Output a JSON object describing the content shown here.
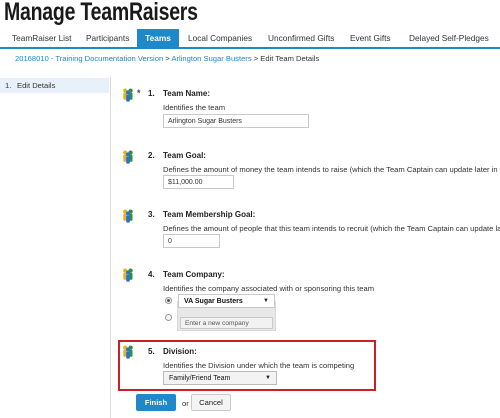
{
  "page": {
    "title": "Manage TeamRaisers"
  },
  "tabs": [
    {
      "label": "TeamRaiser List"
    },
    {
      "label": "Participants"
    },
    {
      "label": "Teams"
    },
    {
      "label": "Local Companies"
    },
    {
      "label": "Unconfirmed Gifts"
    },
    {
      "label": "Event Gifts"
    },
    {
      "label": "Delayed Self-Pledges"
    }
  ],
  "breadcrumb": {
    "item1": "20168010 - Training Documentation Version",
    "sep1": " > ",
    "item2": "Arlington Sugar Busters",
    "sep2": " > ",
    "current": "Edit Team Details"
  },
  "sidebar": {
    "items": [
      {
        "number": "1.",
        "label": "Edit Details"
      }
    ]
  },
  "form": {
    "required_marker": "*",
    "steps": [
      {
        "number": "1.",
        "label": "Team Name:",
        "description": "Identifies the team",
        "value": "Arlington Sugar Busters"
      },
      {
        "number": "2.",
        "label": "Team Goal:",
        "description": "Defines the amount of money the team intends to raise (which the Team Captain can update later in the",
        "value": "$11,000.00"
      },
      {
        "number": "3.",
        "label": "Team Membership Goal:",
        "description": "Defines the amount of people that this team intends to recruit (which the Team Captain can update late",
        "value": "0"
      },
      {
        "number": "4.",
        "label": "Team Company:",
        "description": "Identifies the company associated with or sponsoring this team",
        "selected_company": "VA Sugar Busters",
        "new_company_placeholder": "Enter a new company"
      },
      {
        "number": "5.",
        "label": "Division:",
        "description": "Identifies the Division under which the team is competing",
        "selected_division": "Family/Friend Team"
      }
    ]
  },
  "actions": {
    "finish_label": "Finish",
    "or_label": "or",
    "cancel_label": "Cancel"
  },
  "colors": {
    "accent": "#1e88c8",
    "highlight_border": "#cc1f27"
  },
  "icons": {
    "step_icon": "team-people-icon",
    "caret": "chevron-down-icon"
  }
}
